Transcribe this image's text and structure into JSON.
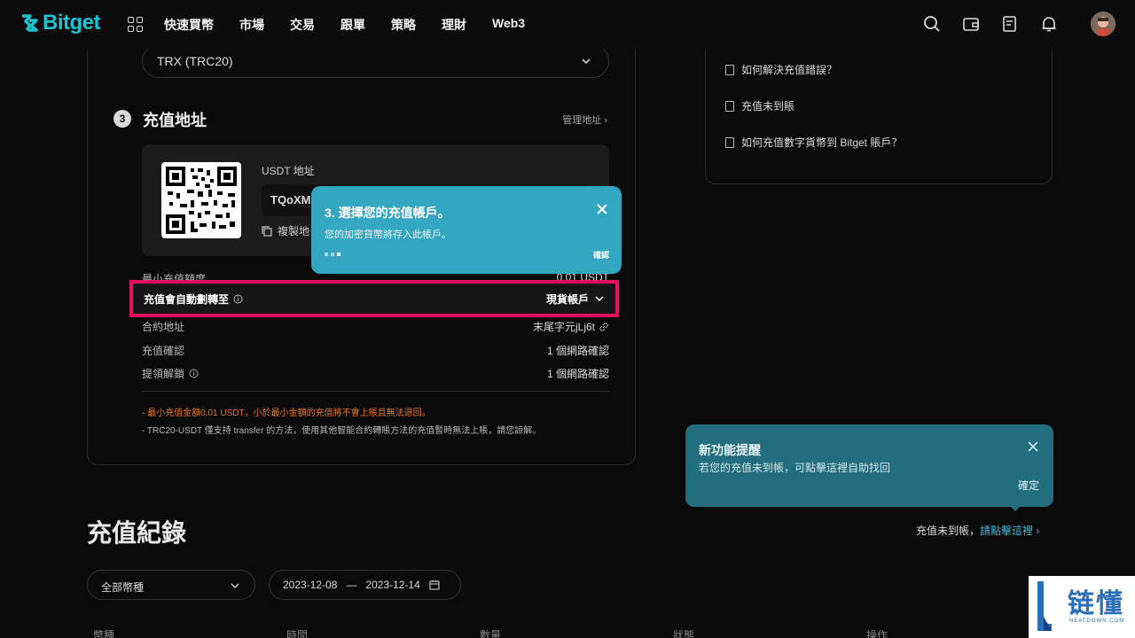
{
  "brand": {
    "name": "Bitget",
    "accent": "#1dc2d3"
  },
  "nav": {
    "items": [
      "快速買幣",
      "市場",
      "交易",
      "跟單",
      "策略",
      "理財",
      "Web3"
    ]
  },
  "deposit": {
    "network_value": "TRX (TRC20)",
    "step_number": "3",
    "step_title": "充值地址",
    "manage_link": "管理地址",
    "address_label": "USDT 地址",
    "address_value": "TQoXM",
    "copy_label": "複製地",
    "rows": {
      "min_label": "最小充值額度",
      "min_value": "0.01 USDT",
      "auto_label": "充值會自動劃轉至",
      "auto_value": "現貨帳戶",
      "contract_label": "合約地址",
      "contract_value": "末尾字元jLj6t",
      "confirm_label": "充值確認",
      "confirm_value": "1 個網路確認",
      "unlock_label": "提領解鎖",
      "unlock_value": "1 個網路確認"
    },
    "note1": "- 最小充值金額0.01 USDT，小於最小金額的充值將不會上賬且無法退回。",
    "note2": "- TRC20-USDT 僅支持 transfer 的方法，使用其他智能合約轉賬方法的充值暫時無法上賬，請您諒解。"
  },
  "faq": {
    "items": [
      "如何解決充值錯誤？",
      "充值未到賬",
      "如何充值數字貨幣到 Bitget 賬戶？"
    ]
  },
  "tooltip": {
    "title": "3. 選擇您的充值帳戶。",
    "text": "您的加密貨幣將存入此帳戶。",
    "ok": "確認",
    "color": "#33a7c2"
  },
  "records": {
    "title": "充值紀錄",
    "hint_prefix": "充值未到帳，",
    "hint_link": "請點擊這裡",
    "coin_filter": "全部幣種",
    "date_from": "2023-12-08",
    "date_sep": "—",
    "date_to": "2023-12-14",
    "columns": [
      "幣種",
      "時間",
      "數量",
      "狀態",
      "操作"
    ]
  },
  "feature_popup": {
    "title": "新功能提醒",
    "text": "若您的充值未到帳，可點擊這裡自助找回",
    "ok": "確定"
  },
  "watermark": {
    "text": "链懂",
    "sub": "NEATDOWN.COM"
  }
}
